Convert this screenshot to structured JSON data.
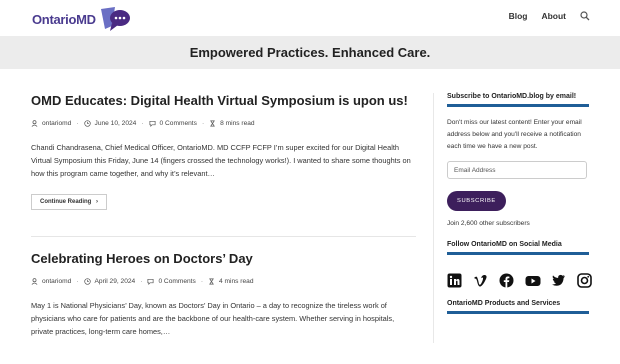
{
  "header": {
    "logo_text": "OntarioMD",
    "nav": [
      "Blog",
      "About"
    ],
    "search_icon": "search-icon"
  },
  "hero": {
    "title": "Empowered Practices. Enhanced Care."
  },
  "posts": [
    {
      "title": "OMD Educates: Digital Health Virtual Symposium is upon us!",
      "author": "ontariomd",
      "date": "June 10, 2024",
      "comments": "0 Comments",
      "read": "8 mins read",
      "excerpt": "Chandi Chandrasena, Chief Medical Officer, OntarioMD. MD CCFP FCFP I’m super excited for our Digital Health Virtual Symposium this Friday, June 14 (fingers crossed the technology works!).   I wanted to share some thoughts on how this program came together, and why it’s relevant…",
      "button": "Continue Reading"
    },
    {
      "title": "Celebrating Heroes on Doctors’ Day",
      "author": "ontariomd",
      "date": "April 29, 2024",
      "comments": "0 Comments",
      "read": "4 mins read",
      "excerpt": "May 1 is National Physicians’ Day, known as Doctors’ Day in Ontario – a day to recognize the tireless work of physicians who care for patients and are the backbone of our health-care system. Whether serving in hospitals, private practices, long-term care homes,…"
    }
  ],
  "sidebar": {
    "subscribe_title": "Subscribe to OntarioMD.blog by email!",
    "subscribe_text": "Don't miss our latest content! Enter your email address below and you'll receive a notification each time we have a new post.",
    "email_placeholder": "Email Address",
    "subscribe_button": "SUBSCRIBE",
    "subscribers": "Join 2,600 other subscribers",
    "social_title": "Follow OntarioMD on Social Media",
    "social_icons": [
      "linkedin-icon",
      "vimeo-icon",
      "facebook-icon",
      "youtube-icon",
      "twitter-icon",
      "instagram-icon"
    ],
    "products_title": "OntarioMD Products and Services"
  },
  "colors": {
    "brand_purple": "#4a3b8f",
    "accent_blue": "#1f5e97",
    "button_dark": "#3d1f5c",
    "hero_bg": "#ececec"
  }
}
